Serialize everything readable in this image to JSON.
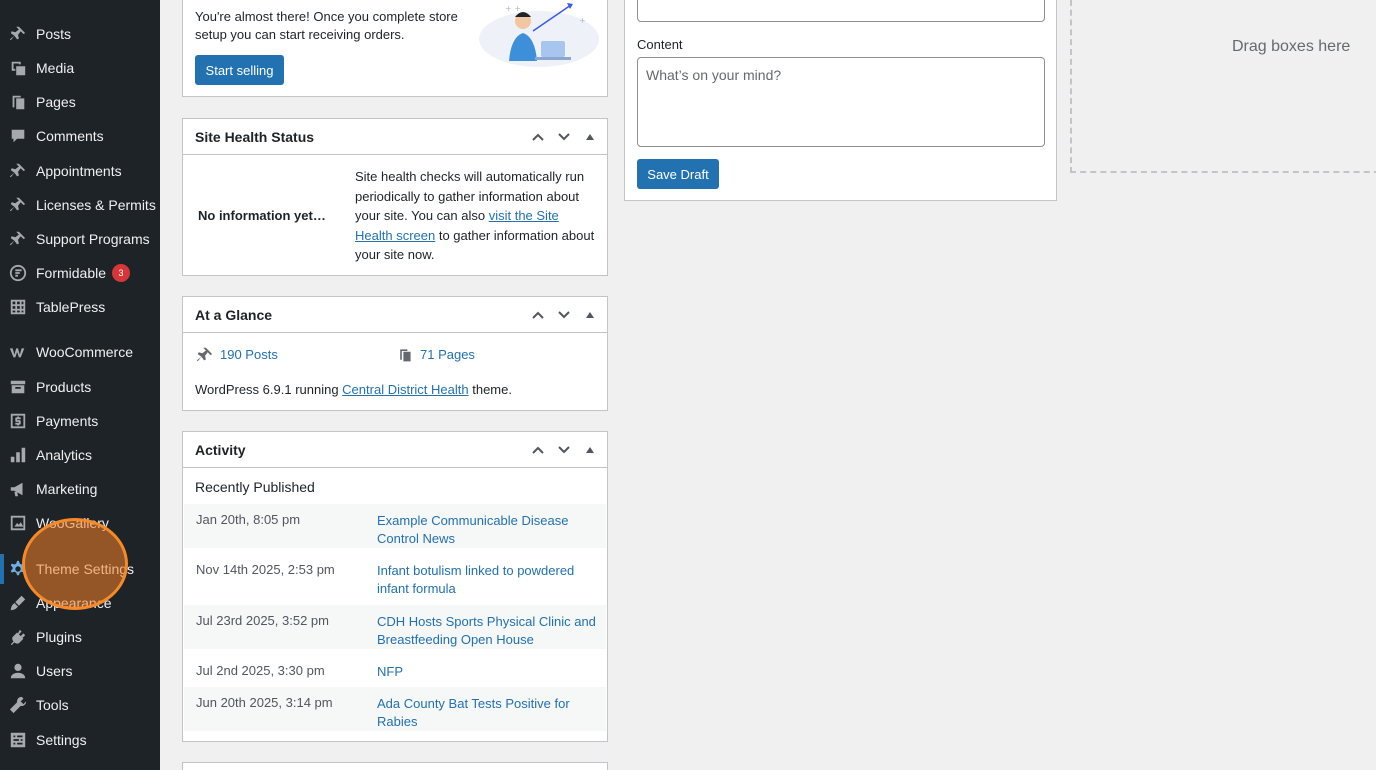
{
  "sidebar": {
    "items": [
      {
        "label": "Posts",
        "icon": "pin-icon"
      },
      {
        "label": "Media",
        "icon": "media-icon"
      },
      {
        "label": "Pages",
        "icon": "pages-icon"
      },
      {
        "label": "Comments",
        "icon": "comments-icon"
      },
      {
        "label": "Appointments",
        "icon": "pin-icon"
      },
      {
        "label": "Licenses & Permits",
        "icon": "pin-icon"
      },
      {
        "label": "Support Programs",
        "icon": "pin-icon"
      },
      {
        "label": "Formidable",
        "icon": "formidable-icon",
        "badge": "3"
      },
      {
        "label": "TablePress",
        "icon": "table-icon"
      },
      {
        "label": "WooCommerce",
        "icon": "woo-icon"
      },
      {
        "label": "Products",
        "icon": "archive-icon"
      },
      {
        "label": "Payments",
        "icon": "dollar-icon"
      },
      {
        "label": "Analytics",
        "icon": "bar-chart-icon"
      },
      {
        "label": "Marketing",
        "icon": "megaphone-icon"
      },
      {
        "label": "WooGallery",
        "icon": "gallery-icon"
      },
      {
        "label": "Theme Settings",
        "icon": "gear-icon"
      },
      {
        "label": "Appearance",
        "icon": "brush-icon"
      },
      {
        "label": "Plugins",
        "icon": "plugin-icon"
      },
      {
        "label": "Users",
        "icon": "user-icon"
      },
      {
        "label": "Tools",
        "icon": "wrench-icon"
      },
      {
        "label": "Settings",
        "icon": "settings-icon"
      }
    ]
  },
  "setup": {
    "text": "You're almost there! Once you complete store setup you can start receiving orders.",
    "button": "Start selling"
  },
  "site_health": {
    "title": "Site Health Status",
    "status": "No information yet…",
    "desc_before": "Site health checks will automatically run periodically to gather information about your site. You can also ",
    "desc_link": "visit the Site Health screen",
    "desc_after": " to gather information about your site now."
  },
  "glance": {
    "title": "At a Glance",
    "posts": "190 Posts",
    "pages": "71 Pages",
    "wp_before": "WordPress 6.9.1 running ",
    "theme_link": "Central District Health",
    "wp_after": " theme."
  },
  "activity": {
    "title": "Activity",
    "heading": "Recently Published",
    "rows": [
      {
        "date": "Jan 20th, 8:05 pm",
        "title": "Example Communicable Disease Control News"
      },
      {
        "date": "Nov 14th 2025, 2:53 pm",
        "title": "Infant botulism linked to powdered infant formula"
      },
      {
        "date": "Jul 23rd 2025, 3:52 pm",
        "title": "CDH Hosts Sports Physical Clinic and Breastfeeding Open House"
      },
      {
        "date": "Jul 2nd 2025, 3:30 pm",
        "title": "NFP"
      },
      {
        "date": "Jun 20th 2025, 3:14 pm",
        "title": "Ada County Bat Tests Positive for Rabies"
      }
    ]
  },
  "quick_draft": {
    "content_label": "Content",
    "content_placeholder": "What’s on your mind?",
    "save_button": "Save Draft"
  },
  "drop_zone": {
    "text": "Drag boxes here"
  },
  "colors": {
    "sidebar_bg": "#1d2327",
    "accent": "#2271b1",
    "badge": "#d63638",
    "highlight": "#f58a2a"
  }
}
